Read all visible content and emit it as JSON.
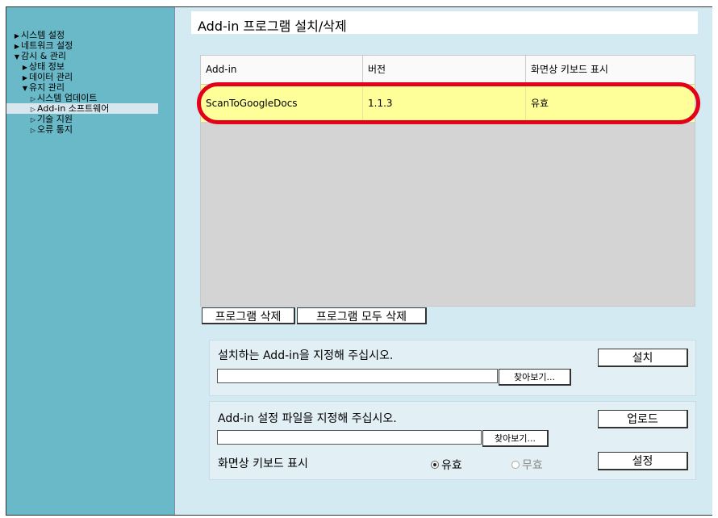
{
  "sidebar": {
    "items": [
      {
        "label": "시스템 설정",
        "arrow": "▶"
      },
      {
        "label": "네트워크 설정",
        "arrow": "▶"
      },
      {
        "label": "감시 & 관리",
        "arrow": "▼"
      },
      {
        "label": "상태 정보",
        "arrow": "▶"
      },
      {
        "label": "데이터 관리",
        "arrow": "▶"
      },
      {
        "label": "유지 관리",
        "arrow": "▼"
      },
      {
        "label": "시스템 업데이트",
        "arrow": "▷"
      },
      {
        "label": "Add-in 소프트웨어",
        "arrow": "▷"
      },
      {
        "label": "기술 지원",
        "arrow": "▷"
      },
      {
        "label": "오류 통지",
        "arrow": "▷"
      }
    ]
  },
  "page": {
    "title": "Add-in 프로그램 설치/삭제"
  },
  "table": {
    "headers": [
      "Add-in",
      "버전",
      "화면상 키보드 표시"
    ],
    "rows": [
      {
        "name": "ScanToGoogleDocs",
        "version": "1.1.3",
        "keyboard": "유효"
      }
    ]
  },
  "actions": {
    "delete_label": "프로그램 삭제",
    "delete_all_label": "프로그램 모두 삭제"
  },
  "install_panel": {
    "label": "설치하는 Add-in을 지정해 주십시오.",
    "file_value": "",
    "browse_label": "찾아보기...",
    "install_label": "설치"
  },
  "settings_panel": {
    "label": "Add-in 설정 파일을 지정해 주십시오.",
    "file_value": "",
    "browse_label": "찾아보기...",
    "upload_label": "업로드",
    "keyboard_label": "화면상 키보드 표시",
    "radio_valid": "유효",
    "radio_invalid": "무효",
    "selected": "유효",
    "set_label": "설정"
  },
  "colors": {
    "sidebar": "#69b9c9",
    "content": "#d4eaf3",
    "selected_row": "#ffff99",
    "highlight": "#e2001a"
  }
}
